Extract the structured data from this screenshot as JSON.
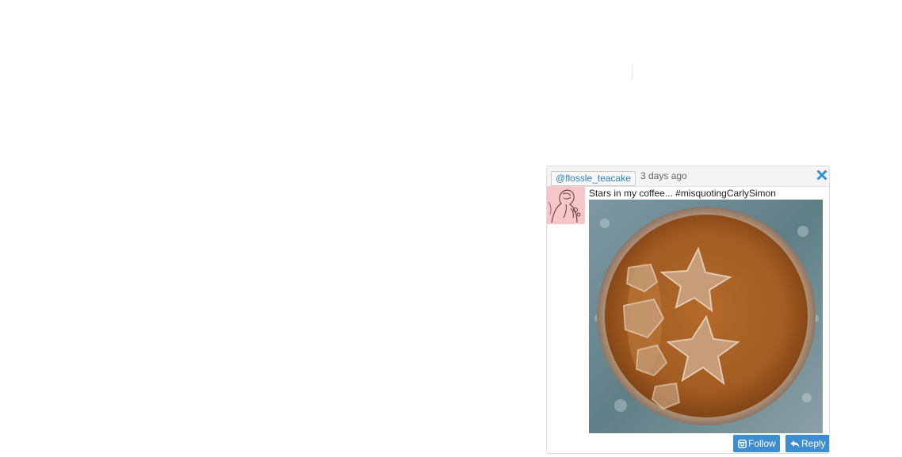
{
  "post": {
    "handle": "@flossle_teacake",
    "time_ago": "3 days ago",
    "caption": "Stars in my coffee... #misquotingCarlySimon",
    "image_alt": "iced coffee with star-shaped ice cubes"
  },
  "actions": {
    "follow_label": "Follow",
    "reply_label": "Reply"
  },
  "colors": {
    "link": "#2f7fc4",
    "button": "#3f8dd1",
    "avatar_bg": "#f7c6c9"
  },
  "icons": [
    "close-icon",
    "instagram-icon",
    "reply-icon"
  ]
}
